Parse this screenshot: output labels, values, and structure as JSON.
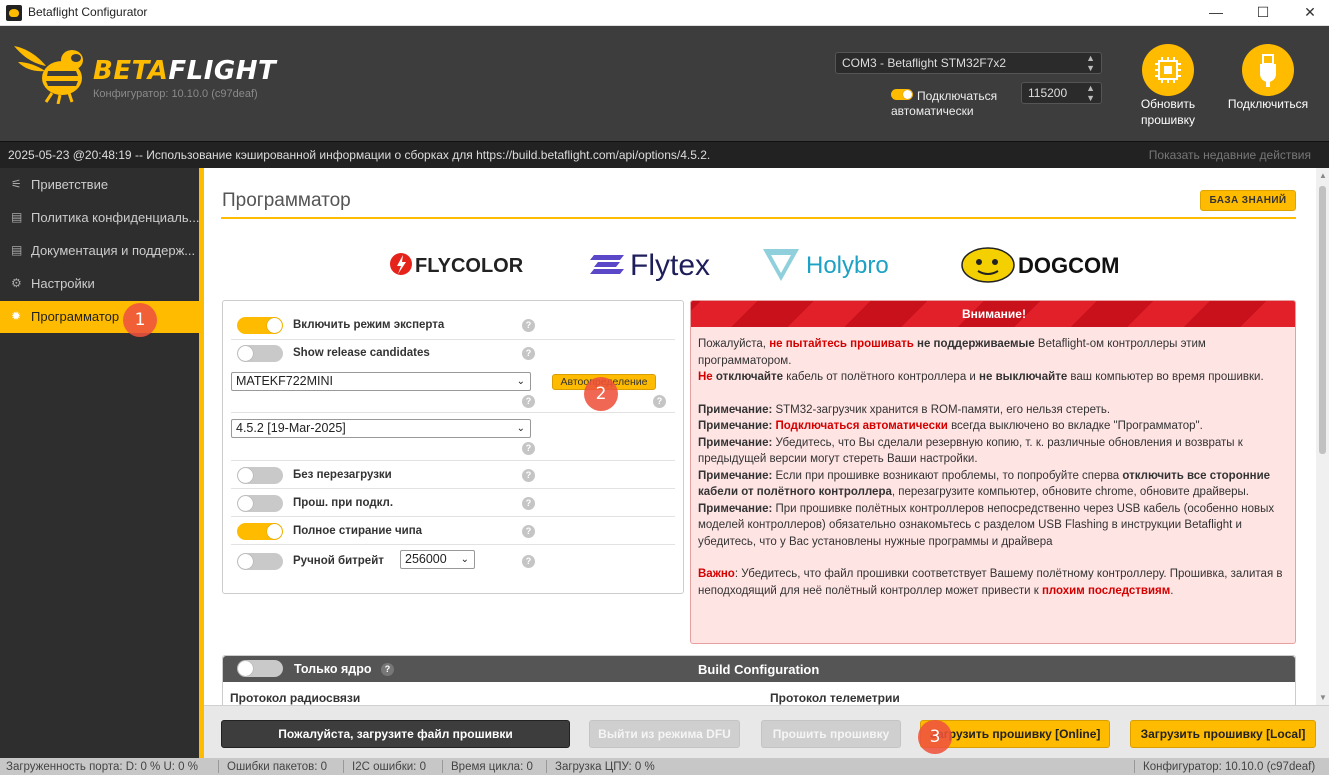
{
  "window": {
    "title": "Betaflight Configurator",
    "minimize": "—",
    "maximize": "☐",
    "close": "✕"
  },
  "header": {
    "logo_beta": "BETA",
    "logo_flight": "FLIGHT",
    "version_label": "Конфигуратор: 10.10.0 (c97deaf)",
    "port": "COM3 - Betaflight STM32F7x2",
    "baud": "115200",
    "auto_connect_line1": "Подключаться",
    "auto_connect_line2": "автоматически",
    "auto_connect_on": true,
    "update_firmware_line1": "Обновить",
    "update_firmware_line2": "прошивку",
    "connect_label": "Подключиться"
  },
  "logbar": {
    "message": "2025-05-23 @20:48:19 -- Использование кэшированной информации о сборках для https://build.betaflight.com/api/options/4.5.2.",
    "recent_actions": "Показать недавние действия"
  },
  "sidebar": {
    "items": [
      {
        "label": "Приветствие",
        "icon": "plug-icon"
      },
      {
        "label": "Политика конфиденциаль...",
        "icon": "document-icon"
      },
      {
        "label": "Документация и поддерж...",
        "icon": "document-icon"
      },
      {
        "label": "Настройки",
        "icon": "gear-icon"
      },
      {
        "label": "Программатор",
        "icon": "chip-icon",
        "active": true
      }
    ]
  },
  "main": {
    "title": "Программатор",
    "knowledge_base": "БАЗА ЗНАНИЙ",
    "brands": [
      "FLYCOLOR",
      "Flytex",
      "Holybro",
      "DOGCOM"
    ],
    "options": {
      "expert_mode": {
        "label": "Включить режим эксперта",
        "on": true
      },
      "release_candidates": {
        "label": "Show release candidates",
        "on": false
      },
      "board": "MATEKF722MINI",
      "auto_detect": "Автоопределение",
      "version": "4.5.2 [19-Mar-2025]",
      "no_reboot": {
        "label": "Без перезагрузки",
        "on": false
      },
      "flash_on_connect": {
        "label": "Прош. при подкл.",
        "on": false
      },
      "full_erase": {
        "label": "Полное стирание чипа",
        "on": true
      },
      "manual_baud": {
        "label": "Ручной битрейт",
        "on": false,
        "value": "256000"
      },
      "help": "?"
    },
    "warning": {
      "title": "Внимание!",
      "p1_a": "Пожалуйста, ",
      "p1_b": "не пытайтесь прошивать",
      "p1_c": " ",
      "p1_d": "не поддерживаемые",
      "p1_e": " Betaflight-ом контроллеры этим программатором.",
      "p2_a": "Не",
      "p2_b": " отключайте",
      "p2_c": " кабель от полётного контроллера и ",
      "p2_d": "не выключайте",
      "p2_e": " ваш компьютер во время прошивки.",
      "note": "Примечание:",
      "n1": " STM32-загрузчик хранится в ROM-памяти, его нельзя стереть.",
      "n2_a": " ",
      "n2_b": "Подключаться автоматически",
      "n2_c": " всегда выключено во вкладке \"Программатор\".",
      "n3": " Убедитесь, что Вы сделали резервную копию, т. к. различные обновления и возвраты к предыдущей версии могут стереть Ваши настройки.",
      "n4_a": " Если при прошивке возникают проблемы, то попробуйте сперва ",
      "n4_b": "отключить все сторонние кабели от полётного контроллера",
      "n4_c": ", перезагрузите компьютер, обновите chrome, обновите драйверы.",
      "n5": " При прошивке полётных контроллеров непосредственно через USB кабель (особенно новых моделей контроллеров) обязательно ознакомьтесь с разделом USB Flashing в инструкции Betaflight и убедитесь, что у Вас установлены нужные программы и драйвера",
      "imp_a": "Важно",
      "imp_b": ": Убедитесь, что файл прошивки соответствует Вашему полётному контроллеру. Прошивка, залитая в неподходящий для неё полётный контроллер может привести к ",
      "imp_c": "плохим последствиям",
      "imp_d": "."
    },
    "build": {
      "core_only": "Только ядро",
      "core_only_on": false,
      "title": "Build Configuration",
      "radio_protocol": "Протокол радиосвязи",
      "telemetry_protocol": "Протокол телеметрии"
    }
  },
  "actions": {
    "load_file": "Пожалуйста, загрузите файл прошивки",
    "exit_dfu": "Выйти из режима DFU",
    "flash": "Прошить прошивку",
    "load_online": "Загрузить прошивку [Online]",
    "load_local": "Загрузить прошивку [Local]"
  },
  "statusbar": {
    "port_load": "Загруженность порта: D: 0 % U: 0 %",
    "packet_errors": "Ошибки пакетов: 0",
    "i2c_errors": "I2C ошибки: 0",
    "cycle_time": "Время цикла: 0",
    "cpu_load": "Загрузка ЦПУ: 0 %",
    "configurator": "Конфигуратор: 10.10.0 (c97deaf)"
  },
  "markers": [
    "1",
    "2",
    "3"
  ],
  "colors": {
    "accent": "#ffbb00",
    "header_bg": "#3d3d3d",
    "warning_red": "#e2202a"
  }
}
